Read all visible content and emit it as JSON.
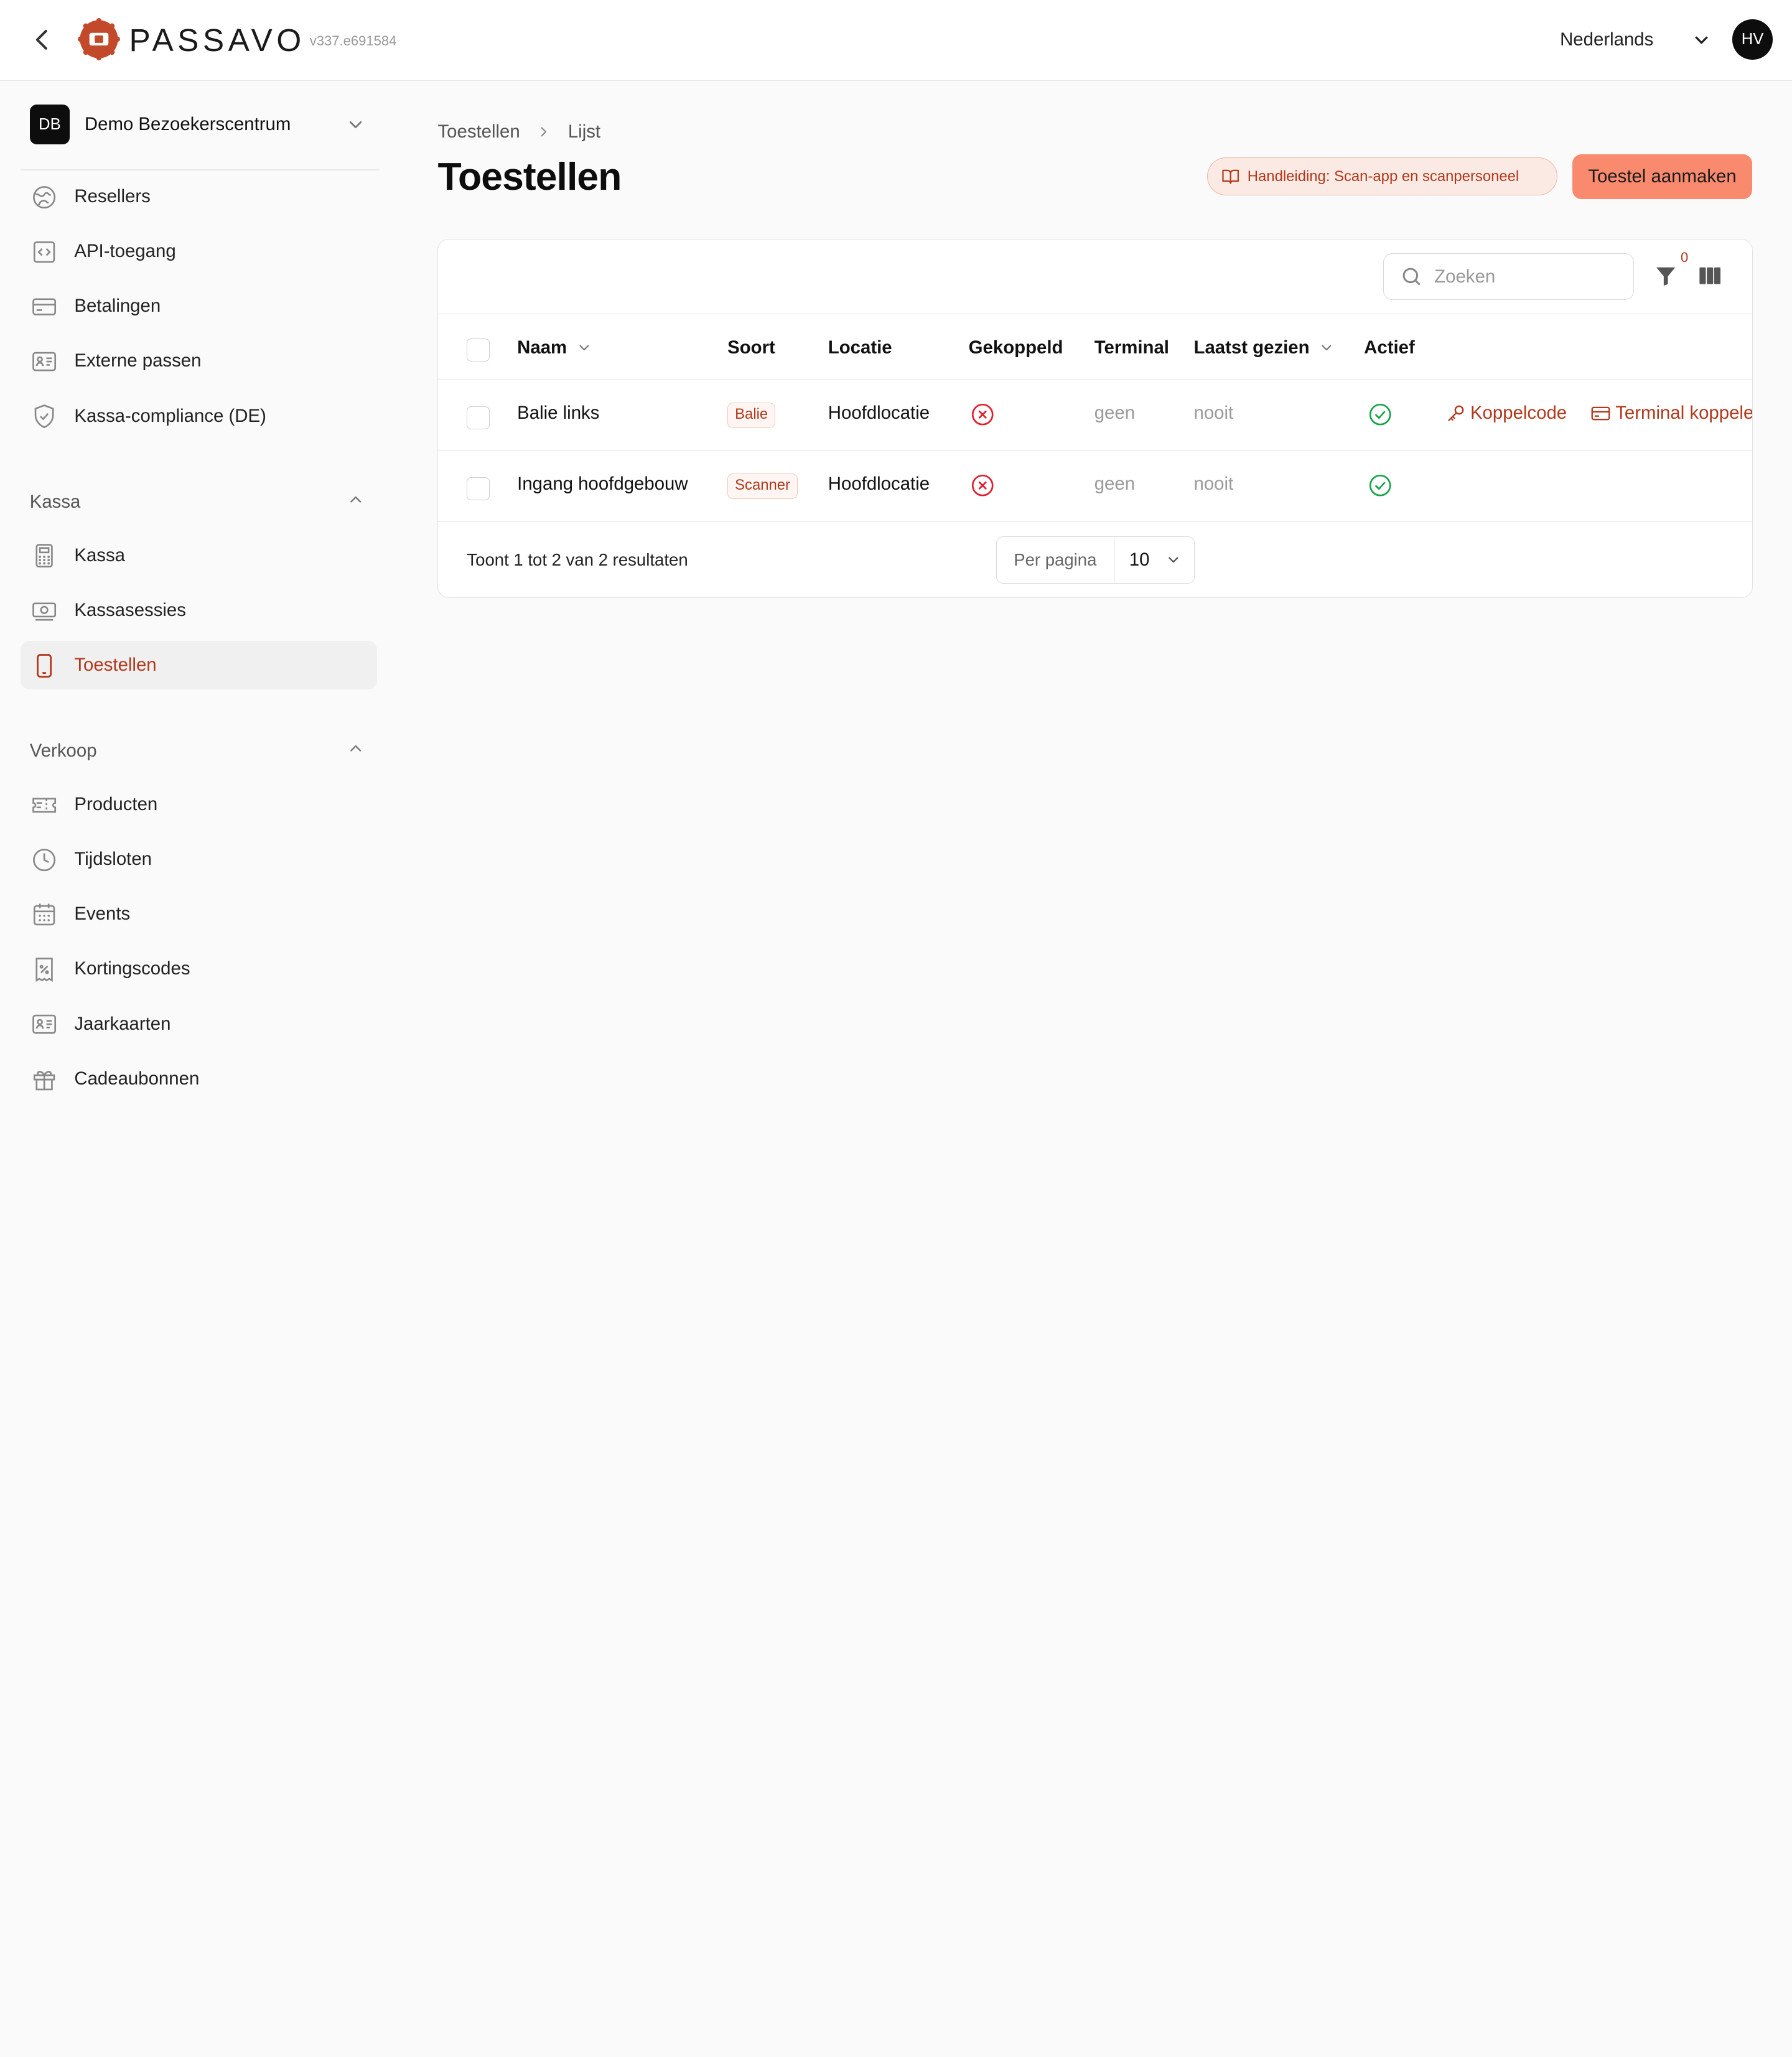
{
  "header": {
    "brand": "PASSAVO",
    "version": "v337.e691584",
    "language": "Nederlands",
    "avatar_initials": "HV"
  },
  "sidebar": {
    "org": {
      "initials": "DB",
      "name": "Demo Bezoekerscentrum"
    },
    "top_items": [
      {
        "label": "Resellers",
        "icon": "globe-icon"
      },
      {
        "label": "API-toegang",
        "icon": "code-icon"
      },
      {
        "label": "Betalingen",
        "icon": "credit-card-icon"
      },
      {
        "label": "Externe passen",
        "icon": "id-card-icon"
      },
      {
        "label": "Kassa-compliance (DE)",
        "icon": "shield-check-icon"
      }
    ],
    "sections": [
      {
        "title": "Kassa",
        "items": [
          {
            "label": "Kassa",
            "icon": "calculator-icon"
          },
          {
            "label": "Kassasessies",
            "icon": "banknote-icon"
          },
          {
            "label": "Toestellen",
            "icon": "phone-icon",
            "active": true
          }
        ]
      },
      {
        "title": "Verkoop",
        "items": [
          {
            "label": "Producten",
            "icon": "ticket-icon"
          },
          {
            "label": "Tijdsloten",
            "icon": "clock-icon"
          },
          {
            "label": "Events",
            "icon": "calendar-icon"
          },
          {
            "label": "Kortingscodes",
            "icon": "percent-receipt-icon"
          },
          {
            "label": "Jaarkaarten",
            "icon": "id-card-icon"
          },
          {
            "label": "Cadeaubonnen",
            "icon": "gift-icon"
          }
        ]
      }
    ]
  },
  "breadcrumb": [
    "Toestellen",
    "Lijst"
  ],
  "page": {
    "title": "Toestellen",
    "guide_label": "Handleiding: Scan-app en scanpersoneel",
    "create_label": "Toestel aanmaken"
  },
  "toolbar": {
    "search_placeholder": "Zoeken",
    "filter_count": "0"
  },
  "table": {
    "columns": [
      "Naam",
      "Soort",
      "Locatie",
      "Gekoppeld",
      "Terminal",
      "Laatst gezien",
      "Actief"
    ],
    "rows": [
      {
        "naam": "Balie links",
        "soort": "Balie",
        "locatie": "Hoofdlocatie",
        "gekoppeld": false,
        "terminal": "geen",
        "laatst_gezien": "nooit",
        "actief": true,
        "actions": [
          "Koppelcode",
          "Terminal koppelen"
        ]
      },
      {
        "naam": "Ingang hoofdgebouw",
        "soort": "Scanner",
        "locatie": "Hoofdlocatie",
        "gekoppeld": false,
        "terminal": "geen",
        "laatst_gezien": "nooit",
        "actief": true,
        "actions": []
      }
    ],
    "summary": "Toont 1 tot 2 van 2 resultaten",
    "per_page_label": "Per pagina",
    "per_page_value": "10"
  },
  "colors": {
    "accent": "#b0391c",
    "primary_button": "#f98a6e",
    "success": "#16a34a",
    "danger": "#e11d2e"
  }
}
